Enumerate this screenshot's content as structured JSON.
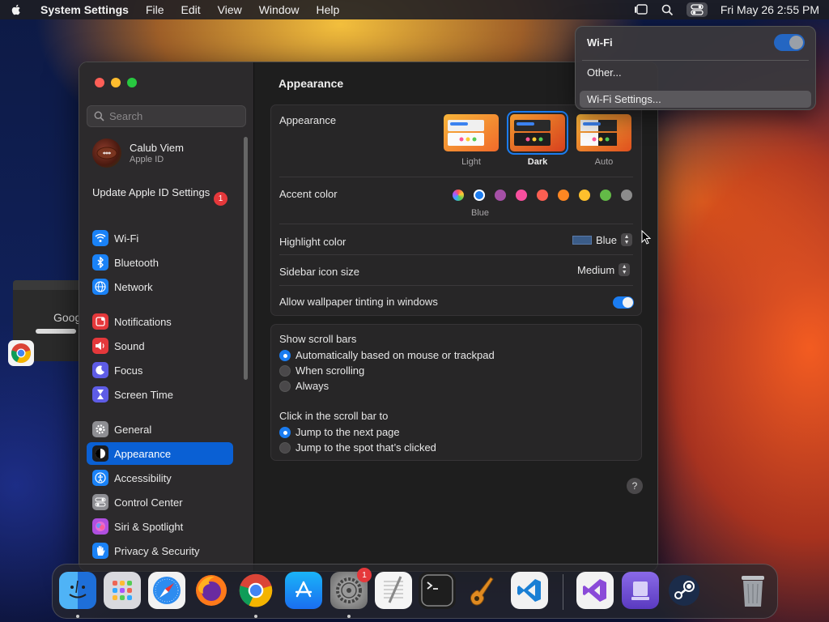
{
  "menubar": {
    "app_name": "System Settings",
    "menus": [
      "File",
      "Edit",
      "View",
      "Window",
      "Help"
    ],
    "datetime": "Fri May 26  2:55 PM"
  },
  "background_window": {
    "text": "Goog"
  },
  "window": {
    "search_placeholder": "Search",
    "profile": {
      "name": "Calub Viem",
      "subtitle": "Apple ID"
    },
    "update": {
      "label": "Update Apple ID Settings",
      "badge": "1"
    },
    "sidebar_items": [
      {
        "label": "Wi-Fi",
        "icon": "wifi-icon",
        "color": "#1a82f7"
      },
      {
        "label": "Bluetooth",
        "icon": "bluetooth-icon",
        "color": "#1a82f7"
      },
      {
        "label": "Network",
        "icon": "globe-icon",
        "color": "#1a82f7"
      },
      {
        "label": "Notifications",
        "icon": "bell-icon",
        "color": "#e5383b"
      },
      {
        "label": "Sound",
        "icon": "speaker-icon",
        "color": "#e5383b"
      },
      {
        "label": "Focus",
        "icon": "moon-icon",
        "color": "#5e5ce6"
      },
      {
        "label": "Screen Time",
        "icon": "hourglass-icon",
        "color": "#5e5ce6"
      },
      {
        "label": "General",
        "icon": "gear-icon",
        "color": "#8e8e93"
      },
      {
        "label": "Appearance",
        "icon": "appearance-icon",
        "color": "#1c1c1e"
      },
      {
        "label": "Accessibility",
        "icon": "accessibility-icon",
        "color": "#1a82f7"
      },
      {
        "label": "Control Center",
        "icon": "control-center-icon",
        "color": "#8e8e93"
      },
      {
        "label": "Siri & Spotlight",
        "icon": "siri-icon",
        "color": "#b04fe0"
      },
      {
        "label": "Privacy & Security",
        "icon": "hand-icon",
        "color": "#1a82f7"
      }
    ],
    "active_item": "Appearance",
    "main": {
      "title": "Appearance",
      "appearance": {
        "label": "Appearance",
        "options": [
          "Light",
          "Dark",
          "Auto"
        ],
        "selected": "Dark"
      },
      "accent": {
        "label": "Accent color",
        "selected_name": "Blue",
        "colors": [
          "multicolor",
          "#1b7cf0",
          "#a550a7",
          "#f74f9e",
          "#fc5f52",
          "#fd8622",
          "#fec02c",
          "#63ba47",
          "#8c8c8c"
        ]
      },
      "highlight": {
        "label": "Highlight color",
        "value": "Blue",
        "swatch": "#3b5c88"
      },
      "icon_size": {
        "label": "Sidebar icon size",
        "value": "Medium"
      },
      "wallpaper_tinting": {
        "label": "Allow wallpaper tinting in windows",
        "on": true
      },
      "scroll_bars": {
        "label": "Show scroll bars",
        "options": [
          "Automatically based on mouse or trackpad",
          "When scrolling",
          "Always"
        ],
        "selected": 0
      },
      "click_scroll": {
        "label": "Click in the scroll bar to",
        "options": [
          "Jump to the next page",
          "Jump to the spot that’s clicked"
        ],
        "selected": 0
      },
      "help": "?"
    }
  },
  "wifi_menu": {
    "title": "Wi-Fi",
    "on": true,
    "items": [
      "Other...",
      "Wi-Fi Settings..."
    ],
    "highlighted": "Wi-Fi Settings..."
  },
  "dock": {
    "apps": [
      {
        "name": "finder-icon",
        "running": true
      },
      {
        "name": "launchpad-icon",
        "running": false
      },
      {
        "name": "safari-icon",
        "running": false
      },
      {
        "name": "firefox-icon",
        "running": false
      },
      {
        "name": "chrome-icon",
        "running": true
      },
      {
        "name": "app-store-icon",
        "running": false
      },
      {
        "name": "system-settings-icon",
        "running": true,
        "badge": "1"
      },
      {
        "name": "textedit-icon",
        "running": false
      },
      {
        "name": "terminal-icon",
        "running": false
      },
      {
        "name": "garageband-icon",
        "running": false
      },
      {
        "name": "vscode-icon",
        "running": false
      },
      {
        "name": "visual-studio-icon",
        "running": false
      },
      {
        "name": "disk-utility-icon",
        "running": false
      },
      {
        "name": "steam-icon",
        "running": false
      },
      {
        "name": "trash-icon",
        "running": false
      }
    ]
  }
}
